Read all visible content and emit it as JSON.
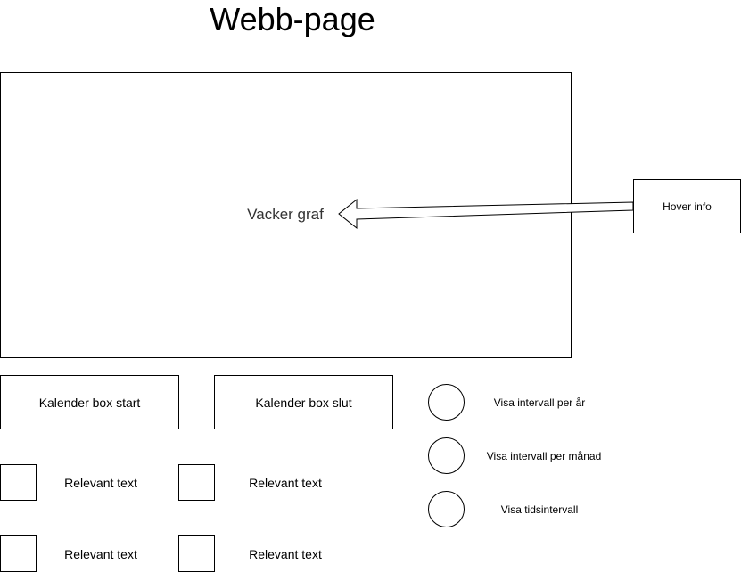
{
  "title": "Webb-page",
  "graph": {
    "label": "Vacker graf"
  },
  "hover_info": {
    "label": "Hover info"
  },
  "calendar": {
    "start_label": "Kalender box start",
    "end_label": "Kalender box slut"
  },
  "checkboxes": [
    {
      "label": "Relevant text"
    },
    {
      "label": "Relevant text"
    },
    {
      "label": "Relevant text"
    },
    {
      "label": "Relevant text"
    }
  ],
  "radio_options": [
    {
      "label": "Visa intervall per år"
    },
    {
      "label": "Visa intervall per månad"
    },
    {
      "label": "Visa tidsintervall"
    }
  ]
}
